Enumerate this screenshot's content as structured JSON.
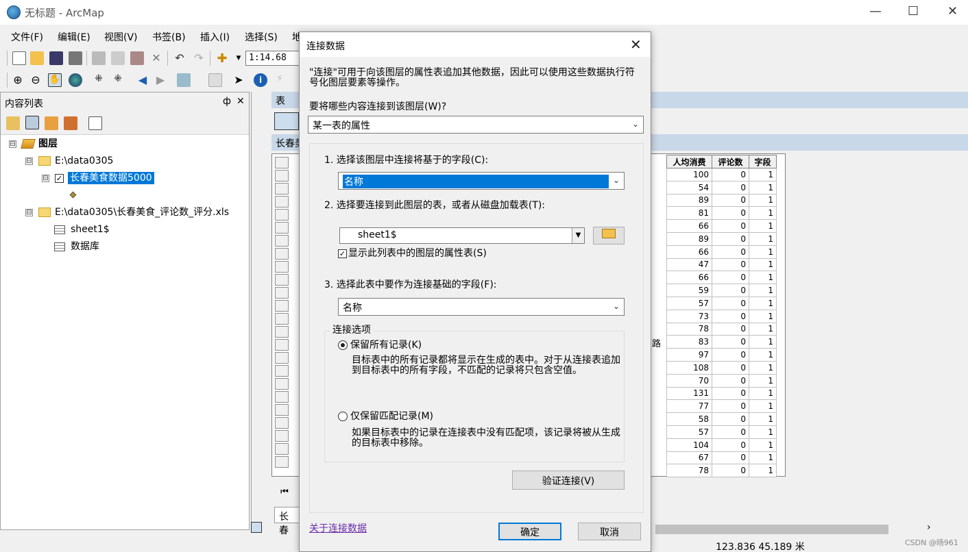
{
  "window": {
    "title": "无标题 - ArcMap"
  },
  "menu": [
    "文件(F)",
    "编辑(E)",
    "视图(V)",
    "书签(B)",
    "插入(I)",
    "选择(S)",
    "地"
  ],
  "toolbar": {
    "scale": "1:14.68"
  },
  "toc": {
    "title": "内容列表",
    "pin": "ф",
    "close": "✕",
    "items": [
      {
        "label": "图层",
        "type": "layers",
        "expander": "⊟"
      },
      {
        "label": "E:\\data0305",
        "type": "folder",
        "expander": "⊟"
      },
      {
        "label": "长春美食数据5000",
        "type": "layer",
        "expander": "⊟",
        "checked": "✓"
      },
      {
        "label": "E:\\data0305\\长春美食_评论数_评分.xls",
        "type": "folder",
        "expander": "⊟"
      },
      {
        "label": "sheet1$",
        "type": "table"
      },
      {
        "label": "数据库",
        "type": "table"
      }
    ]
  },
  "table_window": {
    "title": "表",
    "subtitle": "长春美",
    "bottom_tab": "长春美",
    "columns": [
      "人均消费",
      "评论数",
      "字段"
    ],
    "rows": [
      [
        100,
        0,
        1
      ],
      [
        54,
        0,
        1
      ],
      [
        89,
        0,
        1
      ],
      [
        81,
        0,
        1
      ],
      [
        66,
        0,
        1
      ],
      [
        89,
        0,
        1
      ],
      [
        66,
        0,
        1
      ],
      [
        47,
        0,
        1
      ],
      [
        66,
        0,
        1
      ],
      [
        59,
        0,
        1
      ],
      [
        57,
        0,
        1
      ],
      [
        73,
        0,
        1
      ],
      [
        78,
        0,
        1
      ],
      [
        83,
        0,
        1
      ],
      [
        97,
        0,
        1
      ],
      [
        108,
        0,
        1
      ],
      [
        70,
        0,
        1
      ],
      [
        131,
        0,
        1
      ],
      [
        77,
        0,
        1
      ],
      [
        58,
        0,
        1
      ],
      [
        57,
        0,
        1
      ],
      [
        104,
        0,
        1
      ],
      [
        67,
        0,
        1
      ],
      [
        78,
        0,
        1
      ]
    ],
    "partial_cell": "路"
  },
  "dialog": {
    "title": "连接数据",
    "description": "\"连接\"可用于向该图层的属性表追加其他数据，因此可以使用这些数据执行符号化图层要素等操作。",
    "what_to_join_label": "要将哪些内容连接到该图层(W)?",
    "what_to_join_value": "某一表的属性",
    "step1_label": "1. 选择该图层中连接将基于的字段(C):",
    "step1_value": "名称",
    "step2_label": "2. 选择要连接到此图层的表，或者从磁盘加载表(T):",
    "step2_value": "sheet1$",
    "show_attr_label": "显示此列表中的图层的属性表(S)",
    "show_attr_checked": "✓",
    "step3_label": "3. 选择此表中要作为连接基础的字段(F):",
    "step3_value": "名称",
    "options_title": "连接选项",
    "keep_all_label": "保留所有记录(K)",
    "keep_all_desc": "目标表中的所有记录都将显示在生成的表中。对于从连接表追加到目标表中的所有字段，不匹配的记录将只包含空值。",
    "keep_match_label": "仅保留匹配记录(M)",
    "keep_match_desc": "如果目标表中的记录在连接表中没有匹配项，该记录将被从生成的目标表中移除。",
    "validate_button": "验证连接(V)",
    "about_link": "关于连接数据",
    "ok_button": "确定",
    "cancel_button": "取消"
  },
  "status": {
    "coords": "123.836  45.189 米",
    "watermark": "CSDN @旸961"
  }
}
